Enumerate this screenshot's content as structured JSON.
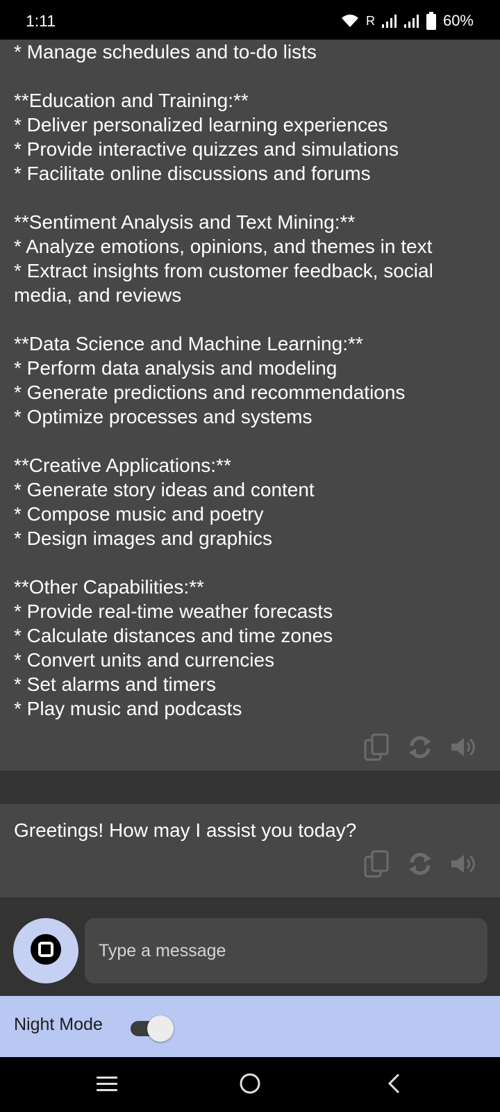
{
  "status_bar": {
    "time": "1:11",
    "roaming": "R",
    "battery": "60%"
  },
  "messages": [
    {
      "lines": [
        "* Manage schedules and to-do lists",
        "",
        "**Education and Training:**",
        "* Deliver personalized learning experiences",
        "* Provide interactive quizzes and simulations",
        "* Facilitate online discussions and forums",
        "",
        "**Sentiment Analysis and Text Mining:**",
        "* Analyze emotions, opinions, and themes in text",
        "* Extract insights from customer feedback, social",
        "media, and reviews",
        "",
        "**Data Science and Machine Learning:**",
        "* Perform data analysis and modeling",
        "* Generate predictions and recommendations",
        "* Optimize processes and systems",
        "",
        "**Creative Applications:**",
        "* Generate story ideas and content",
        "* Compose music and poetry",
        "* Design images and graphics",
        "",
        "**Other Capabilities:**",
        "* Provide real-time weather forecasts",
        "* Calculate distances and time zones",
        "* Convert units and currencies",
        "* Set alarms and timers",
        "* Play music and podcasts"
      ]
    },
    {
      "text": "Greetings! How may I assist you today?"
    }
  ],
  "input": {
    "placeholder": "Type a message"
  },
  "night_mode": {
    "label": "Night Mode",
    "enabled": true
  },
  "icons": {
    "copy": "copy-icon",
    "regenerate": "refresh-icon",
    "speak": "speaker-icon",
    "stop": "stop-icon",
    "nav_menu": "menu-icon",
    "nav_home": "home-icon",
    "nav_back": "back-icon"
  },
  "colors": {
    "bubble": "#474747",
    "background": "#333333",
    "accent": "#c5d0f3",
    "night_bar": "#b9c8f2"
  }
}
